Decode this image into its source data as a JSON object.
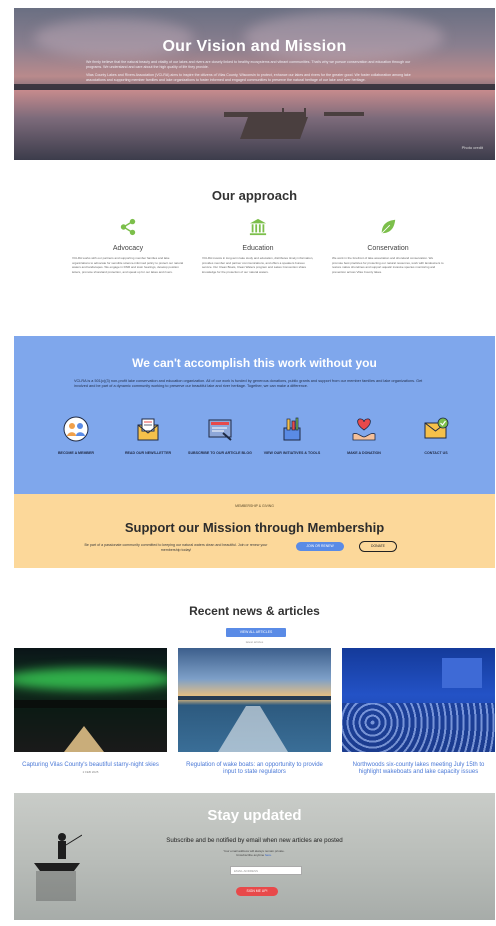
{
  "hero": {
    "title": "Our Vision and Mission",
    "paragraphs": [
      "We firmly believe that the natural beauty and vitality of our lakes and rivers are closely linked to healthy ecosystems and vibrant communities. That's why we pursue conservation and education through our programs. We understand and care about the high quality of life they provide.",
      "Vilas County Lakes and Rivers Association (VCLRA) aims to inspire the citizens of Vilas County, Wisconsin to protect, enhance our lakes and rivers for the greater good. We foster collaboration among lake associations and supporting member families and lake organizations to foster informed and engaged communities to preserve the natural heritage of our lake and river heritage."
    ],
    "credit": "Photo credit"
  },
  "approach": {
    "title": "Our approach",
    "columns": [
      {
        "label": "Advocacy",
        "icon": "share-icon",
        "text": "VCLRA works with our partners and supporting member families and lake organizations to advocate for sensible science-informed policy to protect our natural waters and landscapes. We engage in DNR and town hearings, develop position letters, promote shoreland protection, and speak up for our lakes and rivers."
      },
      {
        "label": "Education",
        "icon": "building-icon",
        "text": "VCLRA invests in long-term lake study and education, distributes timely information, provides member and partner communications, and offers a speakers bureau service. Our Clean Boats, Clean Waters program and Lakes Convention share knowledge for the protection of our natural waters."
      },
      {
        "label": "Conservation",
        "icon": "leaf-icon",
        "text": "We work in the forefront of lake association and shoreland conservation. We promote best practices for protecting our natural resources, work with landowners to restore native shorelines and support aquatic invasive species monitoring and prevention across Vilas County lakes."
      }
    ]
  },
  "support": {
    "title": "We can't accomplish this work without you",
    "description": "VCLRA is a 501(c)(3) non-profit lake conservation and education organization. All of our work is funded by generous donations, public grants and support from our member families and lake organizations. Get involved and be part of a dynamic community working to preserve our beautiful lake and river heritage. Together, we can make a difference.",
    "actions": [
      {
        "label": "BECOME A MEMBER",
        "icon": "member-icon"
      },
      {
        "label": "READ OUR NEWS-LETTER",
        "icon": "newsletter-icon"
      },
      {
        "label": "SUBSCRIBE TO OUR ARTICLE BLOG",
        "icon": "blog-icon"
      },
      {
        "label": "VIEW OUR INITIATIVES & TOOLS",
        "icon": "tools-icon"
      },
      {
        "label": "MAKE A DONATION",
        "icon": "donation-icon"
      },
      {
        "label": "CONTACT US",
        "icon": "contact-icon"
      }
    ]
  },
  "membership": {
    "kicker": "MEMBERSHIP & GIVING",
    "title": "Support our Mission through Membership",
    "description": "Be part of a passionate community committed to keeping our natural waters clean and beautiful. Join or renew your membership today!",
    "join_label": "JOIN OR RENEW",
    "donate_label": "DONATE"
  },
  "news": {
    "title": "Recent news & articles",
    "view_all_label": "VIEW ALL ARTICLES",
    "note": "latest articles",
    "articles": [
      {
        "title": "Capturing Vilas County's beautiful starry-night skies",
        "date": "2 FEB 2025"
      },
      {
        "title": "Regulation of wake boats: an opportunity to provide input to state regulators",
        "date": ""
      },
      {
        "title": "Northwoods six-county lakes meeting July 15th to highlight wakeboats and lake capacity issues",
        "date": ""
      }
    ]
  },
  "stay": {
    "title": "Stay updated",
    "subtitle": "Subscribe and be notified by email when new articles are posted",
    "fine_1": "Your email address will always remain private.",
    "fine_2": "Unsubscribe anytime",
    "fine_link": "here.",
    "email_placeholder": "EMAIL ADDRESS",
    "signup_label": "SIGN ME UP!"
  },
  "colors": {
    "accent_blue": "#5a8be6",
    "support_bg": "#7fa7ec",
    "membership_bg": "#fcd89a",
    "signup_red": "#e8494a",
    "icon_green": "#7cbf4b"
  }
}
